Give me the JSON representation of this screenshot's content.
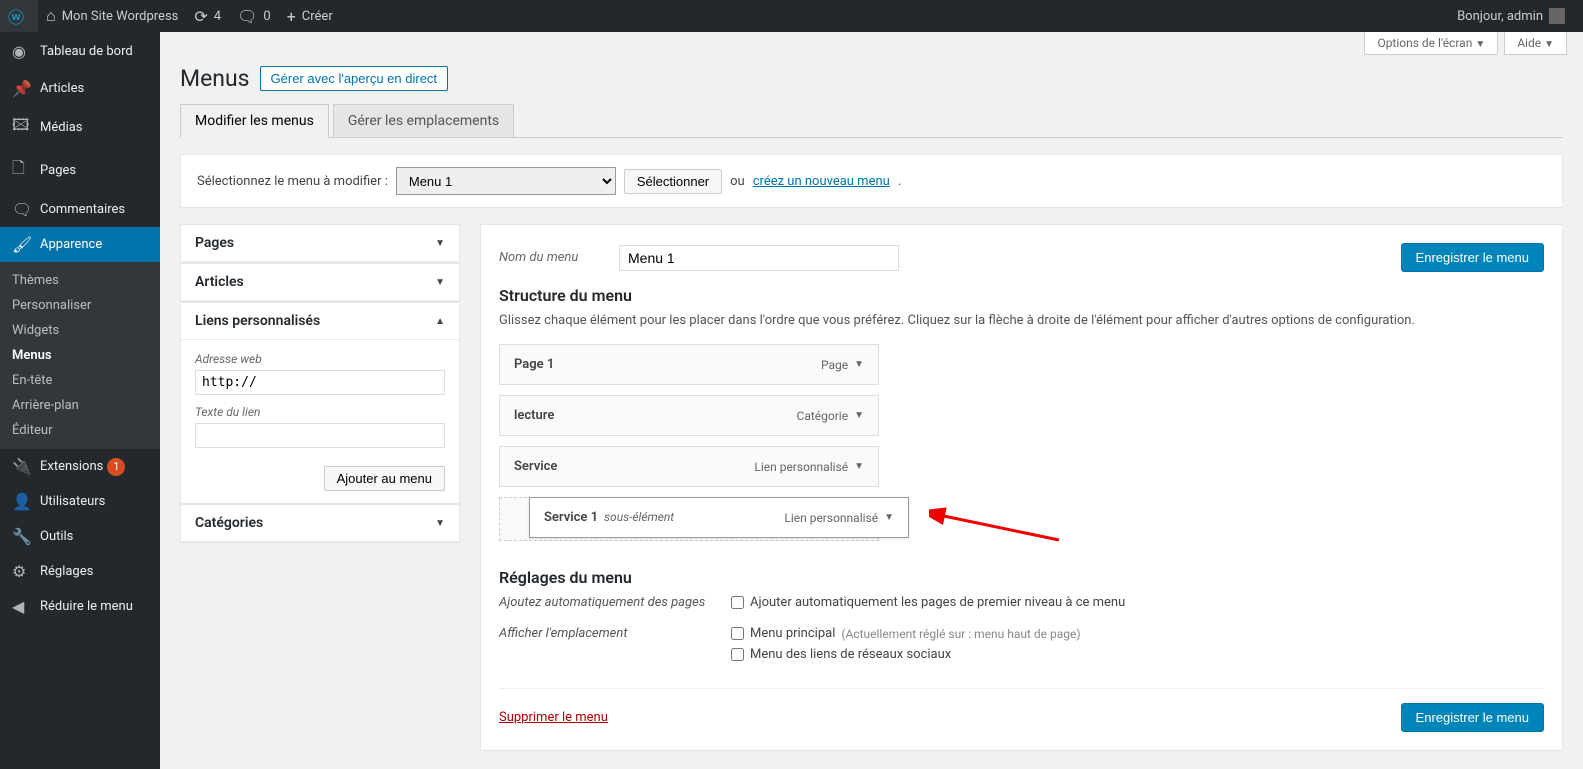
{
  "toolbar": {
    "site_name": "Mon Site Wordpress",
    "updates": "4",
    "comments": "0",
    "create": "Créer",
    "greeting": "Bonjour, admin"
  },
  "screen_options": {
    "label": "Options de l'écran",
    "help": "Aide"
  },
  "sidebar": {
    "dashboard": "Tableau de bord",
    "posts": "Articles",
    "media": "Médias",
    "pages": "Pages",
    "comments": "Commentaires",
    "appearance": "Apparence",
    "appearance_sub": {
      "themes": "Thèmes",
      "customize": "Personnaliser",
      "widgets": "Widgets",
      "menus": "Menus",
      "header": "En-tête",
      "background": "Arrière-plan",
      "editor": "Éditeur"
    },
    "plugins": "Extensions",
    "plugins_badge": "1",
    "users": "Utilisateurs",
    "tools": "Outils",
    "settings": "Réglages",
    "collapse": "Réduire le menu"
  },
  "page": {
    "title": "Menus",
    "manage_preview": "Gérer avec l'aperçu en direct",
    "tab_edit": "Modifier les menus",
    "tab_locations": "Gérer les emplacements"
  },
  "selector": {
    "label": "Sélectionnez le menu à modifier :",
    "selected": "Menu 1",
    "button": "Sélectionner",
    "or": "ou",
    "create_link": "créez un nouveau menu",
    "period": "."
  },
  "metaboxes": {
    "pages": "Pages",
    "articles": "Articles",
    "custom_links": "Liens personnalisés",
    "categories": "Catégories",
    "custom_link_fields": {
      "url_label": "Adresse web",
      "url_value": "http://",
      "text_label": "Texte du lien",
      "add_button": "Ajouter au menu"
    }
  },
  "menu_edit": {
    "name_label": "Nom du menu",
    "name_value": "Menu 1",
    "save_button": "Enregistrer le menu",
    "structure_title": "Structure du menu",
    "structure_desc": "Glissez chaque élément pour les placer dans l'ordre que vous préférez. Cliquez sur la flèche à droite de l'élément pour afficher d'autres options de configuration.",
    "items": [
      {
        "title": "Page 1",
        "type": "Page"
      },
      {
        "title": "lecture",
        "type": "Catégorie"
      },
      {
        "title": "Service",
        "type": "Lien personnalisé"
      }
    ],
    "sub_item": {
      "title": "Service 1",
      "sub_label": "sous-élément",
      "type": "Lien personnalisé"
    },
    "settings_title": "Réglages du menu",
    "auto_add_label": "Ajoutez automatiquement des pages",
    "auto_add_checkbox": "Ajouter automatiquement les pages de premier niveau à ce menu",
    "location_label": "Afficher l'emplacement",
    "loc_primary": "Menu principal",
    "loc_primary_note": "(Actuellement réglé sur : menu haut de page)",
    "loc_social": "Menu des liens de réseaux sociaux",
    "delete": "Supprimer le menu"
  }
}
